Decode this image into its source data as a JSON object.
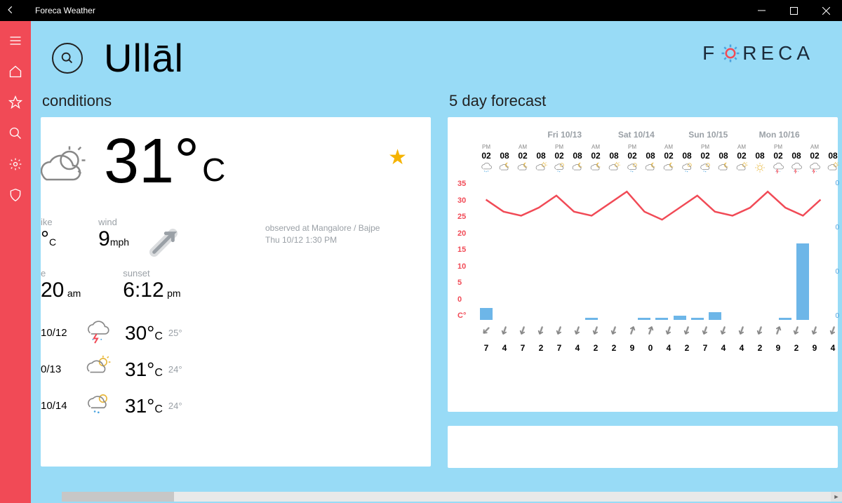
{
  "window": {
    "title": "Foreca Weather"
  },
  "brand": "FORECA",
  "location": "Ullāl",
  "sections": {
    "conditions": "conditions",
    "forecast": "5 day forecast"
  },
  "current": {
    "temp": "31°",
    "unit": "C",
    "observed_line1": "observed at Mangalore / Bajpe",
    "observed_line2": "Thu 10/12 1:30 PM",
    "feels_label": "ike",
    "feels_val": "°",
    "feels_unit": "C",
    "wind_label": "wind",
    "wind_val": "9",
    "wind_unit": "mph",
    "sunrise_label": "e",
    "sunrise_val": "20",
    "sunrise_unit": "am",
    "sunset_label": "sunset",
    "sunset_val": "6:12",
    "sunset_unit": "pm"
  },
  "daily": [
    {
      "date": "10/12",
      "icon": "storm",
      "hi": "30°",
      "unit": "C",
      "lo": "25°"
    },
    {
      "date": "0/13",
      "icon": "partly",
      "hi": "31°",
      "unit": "C",
      "lo": "24°"
    },
    {
      "date": "10/14",
      "icon": "shower",
      "hi": "31°",
      "unit": "C",
      "lo": "24°"
    }
  ],
  "chart_data": {
    "type": "combo",
    "day_headers": [
      "",
      "Fri 10/13",
      "Sat 10/14",
      "Sun 10/15",
      "Mon 10/16"
    ],
    "slots": [
      {
        "ampm": "PM",
        "h": "02",
        "icon": "rain",
        "temp": 30,
        "precip": 3,
        "wdir": 225,
        "wspd": 7
      },
      {
        "ampm": "",
        "h": "08",
        "icon": "nightpartly",
        "temp": 27,
        "precip": 0,
        "wdir": 200,
        "wspd": 4
      },
      {
        "ampm": "AM",
        "h": "02",
        "icon": "nightpartly",
        "temp": 26,
        "precip": 0,
        "wdir": 200,
        "wspd": 7
      },
      {
        "ampm": "",
        "h": "08",
        "icon": "partly",
        "temp": 28,
        "precip": 0,
        "wdir": 200,
        "wspd": 2
      },
      {
        "ampm": "PM",
        "h": "02",
        "icon": "shower",
        "temp": 31,
        "precip": 0,
        "wdir": 200,
        "wspd": 7
      },
      {
        "ampm": "",
        "h": "08",
        "icon": "nightpartly",
        "temp": 27,
        "precip": 0,
        "wdir": 200,
        "wspd": 4
      },
      {
        "ampm": "AM",
        "h": "02",
        "icon": "nightpartly",
        "temp": 26,
        "precip": 0.5,
        "wdir": 200,
        "wspd": 2
      },
      {
        "ampm": "",
        "h": "08",
        "icon": "partly",
        "temp": 29,
        "precip": 0,
        "wdir": 200,
        "wspd": 2
      },
      {
        "ampm": "PM",
        "h": "02",
        "icon": "shower",
        "temp": 32,
        "precip": 0,
        "wdir": 20,
        "wspd": 9
      },
      {
        "ampm": "",
        "h": "08",
        "icon": "nightpartly",
        "temp": 27,
        "precip": 0.5,
        "wdir": 20,
        "wspd": 0
      },
      {
        "ampm": "AM",
        "h": "02",
        "icon": "nightpartly",
        "temp": 25,
        "precip": 0.5,
        "wdir": 200,
        "wspd": 4
      },
      {
        "ampm": "",
        "h": "08",
        "icon": "shower",
        "temp": 28,
        "precip": 1,
        "wdir": 200,
        "wspd": 2
      },
      {
        "ampm": "PM",
        "h": "02",
        "icon": "shower",
        "temp": 31,
        "precip": 0.5,
        "wdir": 200,
        "wspd": 7
      },
      {
        "ampm": "",
        "h": "08",
        "icon": "nightpartly",
        "temp": 27,
        "precip": 2,
        "wdir": 200,
        "wspd": 4
      },
      {
        "ampm": "AM",
        "h": "02",
        "icon": "partly",
        "temp": 26,
        "precip": 0,
        "wdir": 200,
        "wspd": 4
      },
      {
        "ampm": "",
        "h": "08",
        "icon": "sunny",
        "temp": 28,
        "precip": 0,
        "wdir": 200,
        "wspd": 2
      },
      {
        "ampm": "PM",
        "h": "02",
        "icon": "storm",
        "temp": 32,
        "precip": 0,
        "wdir": 20,
        "wspd": 9
      },
      {
        "ampm": "",
        "h": "08",
        "icon": "storm",
        "temp": 28,
        "precip": 0.5,
        "wdir": 200,
        "wspd": 2
      },
      {
        "ampm": "AM",
        "h": "02",
        "icon": "storm",
        "temp": 26,
        "precip": 19,
        "wdir": 200,
        "wspd": 9
      },
      {
        "ampm": "",
        "h": "08",
        "icon": "partly",
        "temp": 30,
        "precip": 0,
        "wdir": 200,
        "wspd": 4
      }
    ],
    "y_temp": [
      "35",
      "30",
      "25",
      "20",
      "15",
      "10",
      "5",
      "0",
      "C°"
    ],
    "y_precip": [
      "0",
      "0",
      "0",
      "0"
    ],
    "temp_min": 0,
    "temp_max": 35,
    "precip_max": 35
  }
}
